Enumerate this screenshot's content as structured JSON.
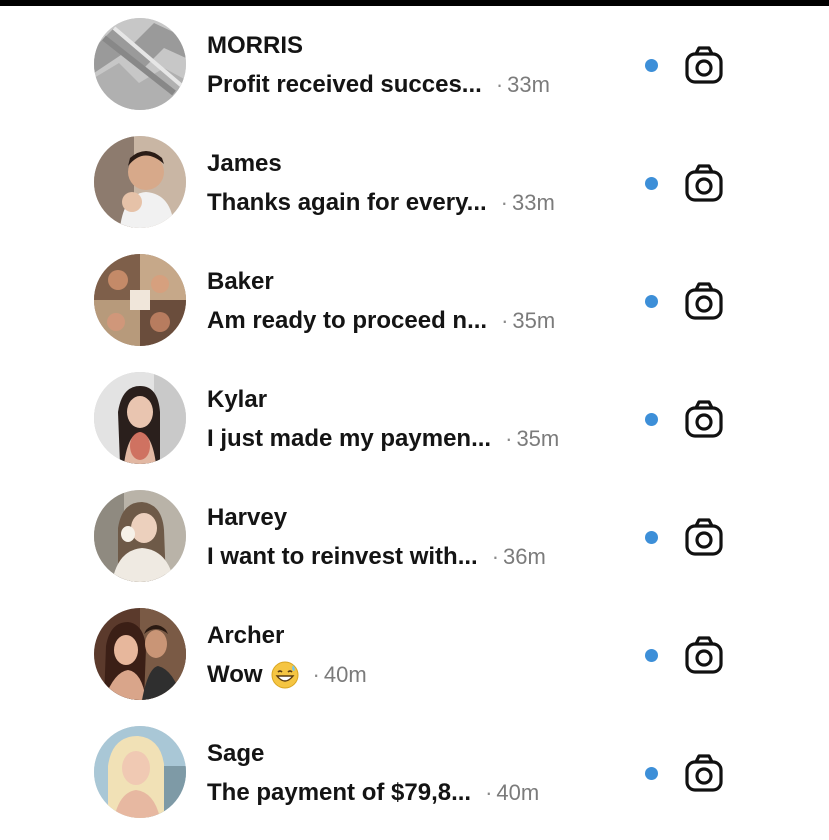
{
  "colors": {
    "unread_dot": "#3d8fd8",
    "name_text": "#141414",
    "time_text": "#7b7b7b",
    "icon_stroke": "#111111"
  },
  "threads": [
    {
      "name": "MORRIS",
      "preview": "Profit received succes...",
      "separator": "·",
      "time": "33m",
      "unread": true,
      "avatar": "generic-avatar-image",
      "action_icon": "camera-icon"
    },
    {
      "name": "James",
      "preview": "Thanks again for every...",
      "separator": "·",
      "time": "33m",
      "unread": true,
      "avatar": "generic-avatar-image",
      "action_icon": "camera-icon"
    },
    {
      "name": "Baker",
      "preview": "Am ready to proceed n...",
      "separator": "·",
      "time": "35m",
      "unread": true,
      "avatar": "generic-avatar-image",
      "action_icon": "camera-icon"
    },
    {
      "name": "Kylar",
      "preview": "I just made my paymen...",
      "separator": "·",
      "time": "35m",
      "unread": true,
      "avatar": "generic-avatar-image",
      "action_icon": "camera-icon"
    },
    {
      "name": "Harvey",
      "preview": "I want to reinvest with...",
      "separator": "·",
      "time": "36m",
      "unread": true,
      "avatar": "generic-avatar-image",
      "action_icon": "camera-icon"
    },
    {
      "name": "Archer",
      "preview": "Wow",
      "preview_emoji": "grinning-sweat-emoji",
      "separator": "·",
      "time": "40m",
      "unread": true,
      "avatar": "generic-avatar-image",
      "action_icon": "camera-icon"
    },
    {
      "name": "Sage",
      "preview": "The payment of $79,8...",
      "separator": "·",
      "time": "40m",
      "unread": true,
      "avatar": "generic-avatar-image",
      "action_icon": "camera-icon"
    }
  ]
}
